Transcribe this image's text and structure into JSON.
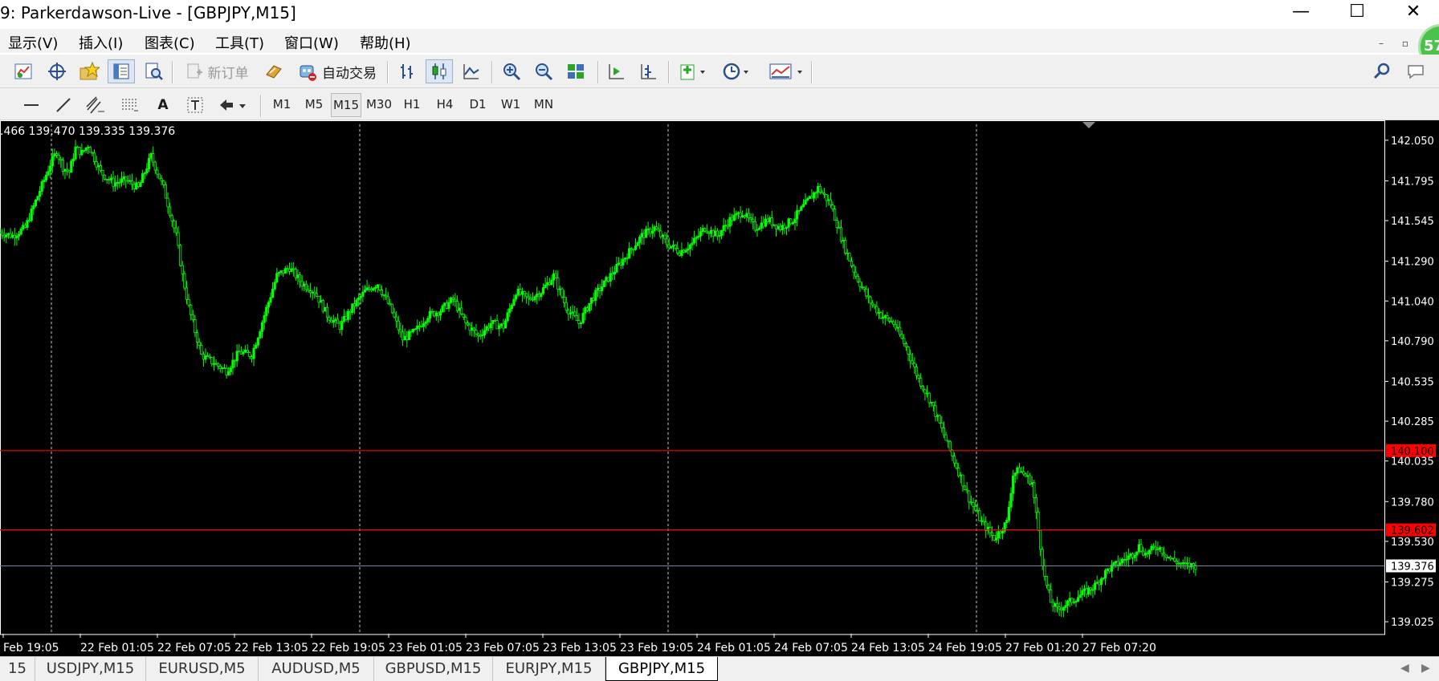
{
  "window": {
    "title": "9: Parkerdawson-Live - [GBPJPY,M15]",
    "minimize_glyph": "—",
    "maximize_glyph": "☐",
    "close_glyph": "✕"
  },
  "menu": {
    "items": [
      "显示(V)",
      "插入(I)",
      "图表(C)",
      "工具(T)",
      "窗口(W)",
      "帮助(H)"
    ],
    "mdi_min_glyph": "–",
    "mdi_restore_glyph": "▫",
    "badge": "57"
  },
  "toolbar": {
    "new_order_label": "新订单",
    "auto_trading_label": "自动交易",
    "icons": [
      "new-chart-icon",
      "crosshair-icon",
      "favorites-icon",
      "market-watch-icon",
      "navigator-icon",
      "new-order-icon",
      "history-icon",
      "auto-trading-icon",
      "bar-chart-icon",
      "candlestick-icon",
      "line-chart-icon",
      "zoom-in-icon",
      "zoom-out-icon",
      "tile-windows-icon",
      "auto-scroll-icon",
      "chart-shift-icon",
      "indicators-icon",
      "periods-icon",
      "templates-icon",
      "search-icon",
      "chat-icon"
    ]
  },
  "drawing_toolbar": {
    "text_tool_label": "A",
    "periods": [
      "M1",
      "M5",
      "M15",
      "M30",
      "H1",
      "H4",
      "D1",
      "W1",
      "MN"
    ],
    "active_period": "M15"
  },
  "chart": {
    "ohlc_text": ".466 139.470 139.335 139.376",
    "colors": {
      "background": "#000000",
      "candle": "#00ff00",
      "grid": "#c8c8c8",
      "level_line": "#ff0000",
      "bid_line": "#778899",
      "axis_text": "#ffffff"
    }
  },
  "chart_data": {
    "type": "line",
    "title": "GBPJPY,M15",
    "xlabel": "",
    "ylabel": "",
    "ylim": [
      138.95,
      142.15
    ],
    "grid": true,
    "y_ticks": [
      "142.050",
      "141.795",
      "141.545",
      "141.290",
      "141.040",
      "140.790",
      "140.535",
      "140.285",
      "140.035",
      "139.780",
      "139.530",
      "139.275",
      "139.025"
    ],
    "x_ticks": [
      "Feb 19:05",
      "22 Feb 01:05",
      "22 Feb 07:05",
      "22 Feb 13:05",
      "22 Feb 19:05",
      "23 Feb 01:05",
      "23 Feb 07:05",
      "23 Feb 13:05",
      "23 Feb 19:05",
      "24 Feb 01:05",
      "24 Feb 07:05",
      "24 Feb 13:05",
      "24 Feb 19:05",
      "27 Feb 01:20",
      "27 Feb 07:20"
    ],
    "horizontal_levels": [
      {
        "price": 140.1,
        "label": "140.100"
      },
      {
        "price": 139.602,
        "label": "139.602"
      }
    ],
    "bid": {
      "price": 139.376,
      "label": "139.376"
    },
    "series": [
      {
        "x": [
          0,
          2,
          4,
          5,
          6,
          7,
          8,
          9,
          10,
          11,
          12,
          13,
          14,
          16,
          18,
          20,
          22,
          24,
          26,
          27,
          28,
          29,
          30,
          31,
          32,
          34,
          36,
          38,
          40,
          42,
          44,
          46,
          48,
          50,
          52,
          54,
          56,
          58,
          60,
          62,
          64,
          66,
          68,
          70,
          72,
          74,
          76,
          78,
          80,
          82,
          84,
          86,
          88,
          90,
          92,
          94,
          96,
          98,
          100,
          102,
          104,
          106,
          108,
          110,
          112,
          114,
          116,
          118,
          120,
          122,
          124,
          126,
          128,
          130,
          132,
          134,
          136,
          138,
          140,
          142,
          144,
          146,
          148,
          150,
          152,
          154,
          156,
          158,
          160,
          161,
          162,
          164,
          165,
          166,
          167,
          168,
          170,
          172,
          174,
          176,
          178,
          180,
          181,
          182,
          184,
          186,
          188,
          190
        ],
        "values": [
          141.47,
          141.45,
          141.5,
          141.6,
          141.7,
          141.8,
          141.9,
          141.98,
          141.88,
          141.85,
          142.0,
          141.97,
          142.02,
          141.85,
          141.78,
          141.8,
          141.75,
          141.95,
          141.75,
          141.6,
          141.45,
          141.2,
          141.0,
          140.85,
          140.7,
          140.65,
          140.6,
          140.72,
          140.7,
          140.95,
          141.2,
          141.25,
          141.15,
          141.1,
          140.95,
          140.88,
          141.0,
          141.1,
          141.15,
          141.0,
          140.8,
          140.85,
          140.95,
          140.98,
          141.05,
          140.9,
          140.82,
          140.9,
          140.88,
          141.1,
          141.05,
          141.1,
          141.2,
          141.0,
          140.9,
          141.05,
          141.15,
          141.25,
          141.35,
          141.45,
          141.5,
          141.4,
          141.35,
          141.4,
          141.5,
          141.45,
          141.55,
          141.6,
          141.5,
          141.55,
          141.5,
          141.55,
          141.65,
          141.75,
          141.65,
          141.4,
          141.2,
          141.05,
          140.95,
          140.9,
          140.75,
          140.55,
          140.4,
          140.2,
          140.0,
          139.8,
          139.65,
          139.55,
          139.65,
          139.95,
          139.98,
          139.9,
          139.6,
          139.3,
          139.15,
          139.1,
          139.15,
          139.2,
          139.25,
          139.35,
          139.4,
          139.45,
          139.5,
          139.45,
          139.5,
          139.42,
          139.38,
          139.376
        ]
      }
    ]
  },
  "tabs": {
    "items": [
      "15",
      "USDJPY,M15",
      "EURUSD,M5",
      "AUDUSD,M5",
      "GBPUSD,M15",
      "EURJPY,M15",
      "GBPJPY,M15"
    ],
    "active": "GBPJPY,M15",
    "scroll_left": "◀",
    "scroll_right": "▶"
  }
}
